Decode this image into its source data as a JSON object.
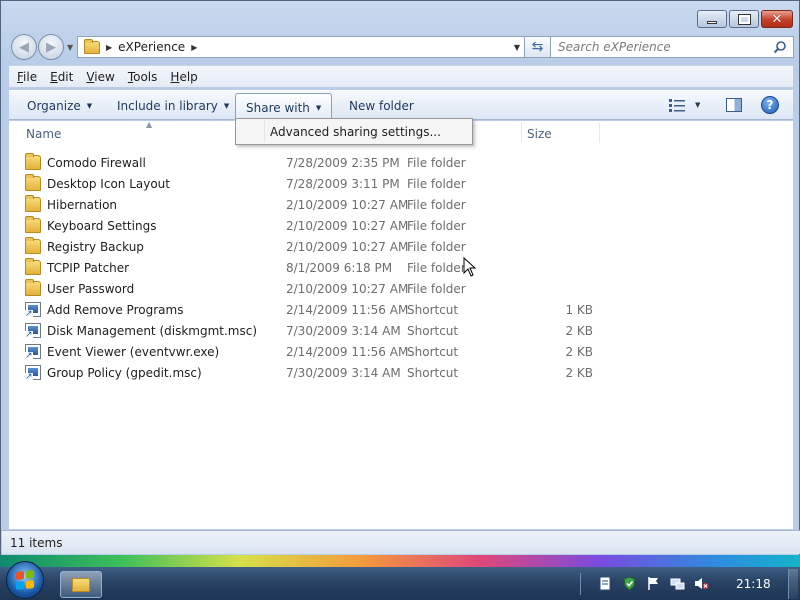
{
  "window": {
    "controls": {
      "minimize": "minimize",
      "maximize": "maximize",
      "close": "close"
    }
  },
  "address": {
    "segments": [
      "eXPerience"
    ],
    "search_placeholder": "Search eXPerience"
  },
  "menubar": {
    "items": [
      {
        "label": "File",
        "underline": "F",
        "rest": "ile"
      },
      {
        "label": "Edit",
        "underline": "E",
        "rest": "dit"
      },
      {
        "label": "View",
        "underline": "V",
        "rest": "iew"
      },
      {
        "label": "Tools",
        "underline": "T",
        "rest": "ools"
      },
      {
        "label": "Help",
        "underline": "H",
        "rest": "elp"
      }
    ]
  },
  "cmdbar": {
    "organize": "Organize",
    "include_in_library": "Include in library",
    "share_with": "Share with",
    "new_folder": "New folder"
  },
  "dropdown": {
    "items": [
      "Advanced sharing settings..."
    ]
  },
  "columns": {
    "name": "Name",
    "size": "Size"
  },
  "files": [
    {
      "name": "Comodo Firewall",
      "date": "7/28/2009 2:35 PM",
      "type": "File folder",
      "size": "",
      "icon": "folder-icon"
    },
    {
      "name": "Desktop Icon Layout",
      "date": "7/28/2009 3:11 PM",
      "type": "File folder",
      "size": "",
      "icon": "folder-icon"
    },
    {
      "name": "Hibernation",
      "date": "2/10/2009 10:27 AM",
      "type": "File folder",
      "size": "",
      "icon": "folder-icon"
    },
    {
      "name": "Keyboard Settings",
      "date": "2/10/2009 10:27 AM",
      "type": "File folder",
      "size": "",
      "icon": "folder-icon"
    },
    {
      "name": "Registry Backup",
      "date": "2/10/2009 10:27 AM",
      "type": "File folder",
      "size": "",
      "icon": "folder-icon"
    },
    {
      "name": "TCPIP Patcher",
      "date": "8/1/2009 6:18 PM",
      "type": "File folder",
      "size": "",
      "icon": "folder-icon"
    },
    {
      "name": "User Password",
      "date": "2/10/2009 10:27 AM",
      "type": "File folder",
      "size": "",
      "icon": "folder-icon"
    },
    {
      "name": "Add Remove Programs",
      "date": "2/14/2009 11:56 AM",
      "type": "Shortcut",
      "size": "1 KB",
      "icon": "shortcut-icon"
    },
    {
      "name": "Disk Management (diskmgmt.msc)",
      "date": "7/30/2009 3:14 AM",
      "type": "Shortcut",
      "size": "2 KB",
      "icon": "shortcut-icon"
    },
    {
      "name": "Event Viewer (eventvwr.exe)",
      "date": "2/14/2009 11:56 AM",
      "type": "Shortcut",
      "size": "2 KB",
      "icon": "shortcut-icon"
    },
    {
      "name": "Group Policy (gpedit.msc)",
      "date": "7/30/2009 3:14 AM",
      "type": "Shortcut",
      "size": "2 KB",
      "icon": "shortcut-icon"
    }
  ],
  "status": {
    "item_count": "11 items"
  },
  "taskbar": {
    "clock": "21:18"
  }
}
